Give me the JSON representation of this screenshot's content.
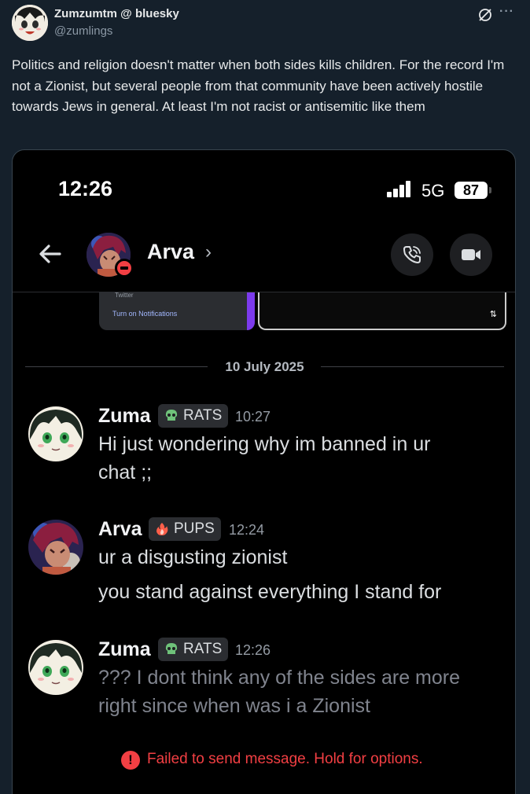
{
  "post": {
    "author_name": "Zumzumtm @ bluesky",
    "author_handle": "@zumlings",
    "more_label": "···",
    "text": "Politics and religion doesn't matter when both sides kills children. For the record I'm not a Zionist, but several people from that community have been actively hostile towards Jews in general. At least I'm not racist or antisemitic like them"
  },
  "screenshot": {
    "status": {
      "time": "12:26",
      "network": "5G",
      "battery": "87"
    },
    "header": {
      "name": "Arva",
      "chevron": "›"
    },
    "previous_embed": {
      "source": "Twitter",
      "action": "Turn on Notifications",
      "reload_icon": "⇅"
    },
    "date_separator": "10 July 2025",
    "messages": [
      {
        "author": "Zuma",
        "tag": "RATS",
        "tag_icon": "skull-icon",
        "time": "10:27",
        "lines": [
          "Hi just wondering why im banned in ur",
          "chat ;;"
        ]
      },
      {
        "author": "Arva",
        "tag": "PUPS",
        "tag_icon": "fire-icon",
        "time": "12:24",
        "lines": [
          "ur a disgusting zionist",
          "you stand against everything I stand for"
        ]
      },
      {
        "author": "Zuma",
        "tag": "RATS",
        "tag_icon": "skull-icon",
        "time": "12:26",
        "lines": [
          "??? I dont think any of the sides are more",
          "right since when was i a Zionist"
        ]
      }
    ],
    "failed": {
      "icon_text": "!",
      "text": "Failed to send message. Hold for options."
    }
  },
  "colors": {
    "page_bg": "#15202b",
    "discord_bg": "#000000",
    "tag_bg": "#2b2d31",
    "error": "#f23f43",
    "muted": "#949ba4"
  }
}
